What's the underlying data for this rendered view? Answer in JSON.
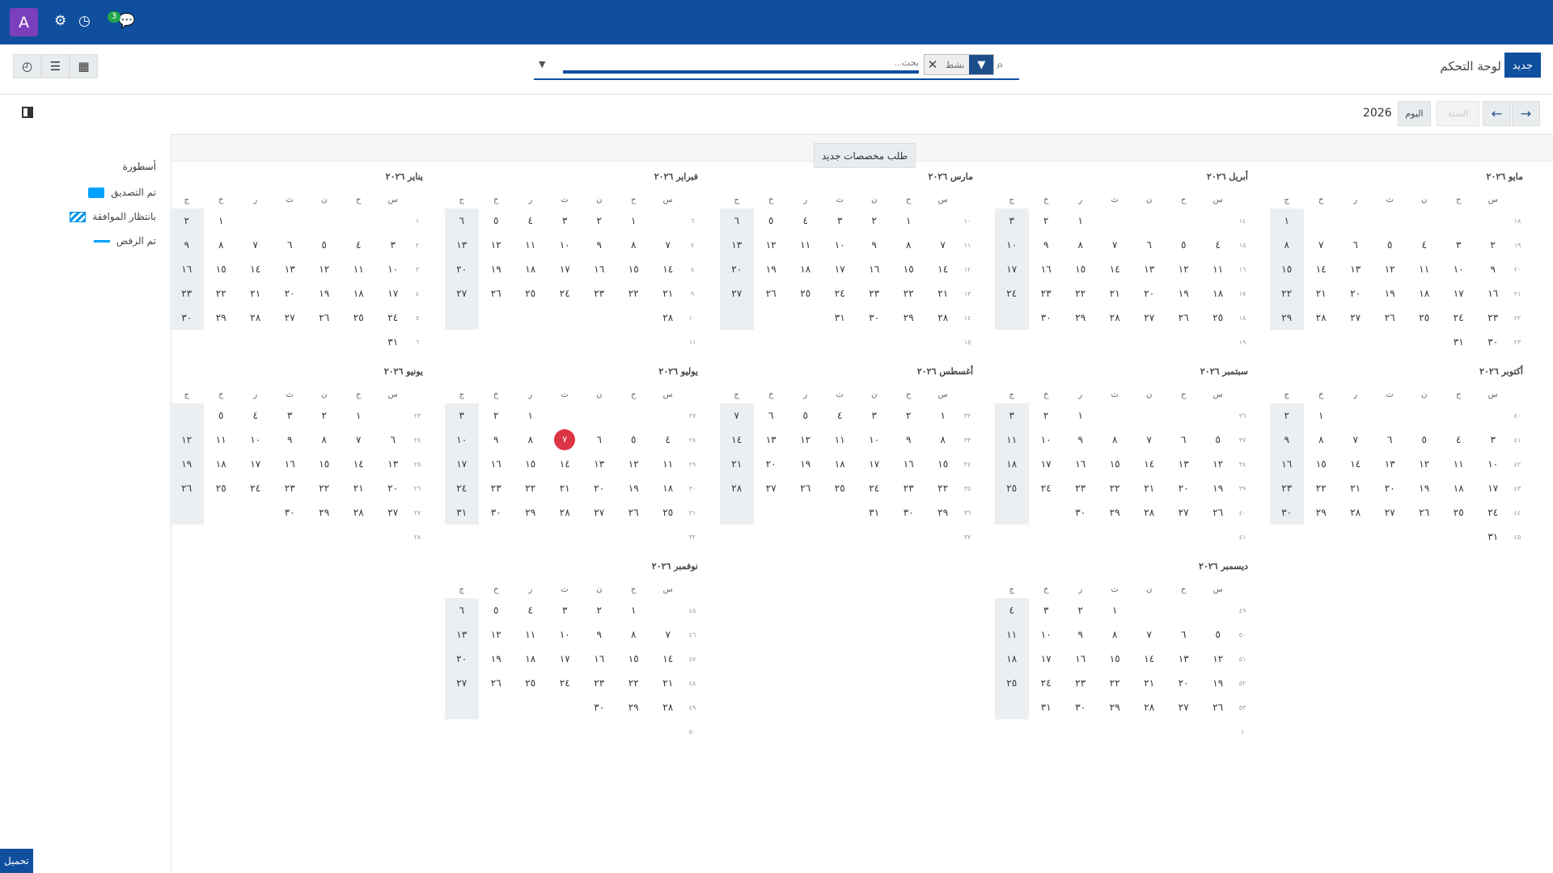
{
  "navbar": {
    "avatar_letter": "A",
    "messages_badge": "3"
  },
  "control_panel": {
    "new_button": "جديد",
    "breadcrumb": "لوحة التحكم",
    "search_placeholder": "بحث...",
    "facet_value": "نشط"
  },
  "toolbar": {
    "today_label": "اليوم",
    "scale_label": "السنة",
    "year": "2026"
  },
  "alloc_button": "طلب مخصصات جديد",
  "legend": {
    "title": "أسطورة",
    "items": [
      {
        "label": "تم التصديق",
        "style": "approved",
        "color": "#00a2ff"
      },
      {
        "label": "بانتظار الموافقة",
        "style": "pending",
        "color": "#0095e8"
      },
      {
        "label": "تم الرفض",
        "style": "refused",
        "color": "#00a2ff"
      }
    ]
  },
  "weekday_headers": [
    "س",
    "ح",
    "ن",
    "ث",
    "ر",
    "خ",
    "ج"
  ],
  "today": {
    "month": 7,
    "day": 7
  },
  "months": [
    {
      "title": "يناير ٢٠٢٦",
      "weeks": [
        "١",
        "٢",
        "٣",
        "٤",
        "٥",
        "٦"
      ],
      "rows": [
        [
          "",
          "",
          "",
          "",
          "",
          "١",
          "٢"
        ],
        [
          "٣",
          "٤",
          "٥",
          "٦",
          "٧",
          "٨",
          "٩"
        ],
        [
          "١٠",
          "١١",
          "١٢",
          "١٣",
          "١٤",
          "١٥",
          "١٦"
        ],
        [
          "١٧",
          "١٨",
          "١٩",
          "٢٠",
          "٢١",
          "٢٢",
          "٢٣"
        ],
        [
          "٢٤",
          "٢٥",
          "٢٦",
          "٢٧",
          "٢٨",
          "٢٩",
          "٣٠"
        ],
        [
          "٣١",
          "",
          "",
          "",
          "",
          "",
          ""
        ]
      ]
    },
    {
      "title": "فبراير ٢٠٢٦",
      "weeks": [
        "٦",
        "٧",
        "٨",
        "٩",
        "١٠",
        "١١"
      ],
      "rows": [
        [
          "",
          "١",
          "٢",
          "٣",
          "٤",
          "٥",
          "٦"
        ],
        [
          "٧",
          "٨",
          "٩",
          "١٠",
          "١١",
          "١٢",
          "١٣"
        ],
        [
          "١٤",
          "١٥",
          "١٦",
          "١٧",
          "١٨",
          "١٩",
          "٢٠"
        ],
        [
          "٢١",
          "٢٢",
          "٢٣",
          "٢٤",
          "٢٥",
          "٢٦",
          "٢٧"
        ],
        [
          "٢٨",
          "",
          "",
          "",
          "",
          "",
          ""
        ],
        [
          "",
          "",
          "",
          "",
          "",
          "",
          ""
        ]
      ]
    },
    {
      "title": "مارس ٢٠٢٦",
      "weeks": [
        "١٠",
        "١١",
        "١٢",
        "١٣",
        "١٤",
        "١٥"
      ],
      "rows": [
        [
          "",
          "١",
          "٢",
          "٣",
          "٤",
          "٥",
          "٦"
        ],
        [
          "٧",
          "٨",
          "٩",
          "١٠",
          "١١",
          "١٢",
          "١٣"
        ],
        [
          "١٤",
          "١٥",
          "١٦",
          "١٧",
          "١٨",
          "١٩",
          "٢٠"
        ],
        [
          "٢١",
          "٢٢",
          "٢٣",
          "٢٤",
          "٢٥",
          "٢٦",
          "٢٧"
        ],
        [
          "٢٨",
          "٢٩",
          "٣٠",
          "٣١",
          "",
          "",
          ""
        ],
        [
          "",
          "",
          "",
          "",
          "",
          "",
          ""
        ]
      ]
    },
    {
      "title": "أبريل ٢٠٢٦",
      "weeks": [
        "١٤",
        "١٥",
        "١٦",
        "١٧",
        "١٨",
        "١٩"
      ],
      "rows": [
        [
          "",
          "",
          "",
          "",
          "١",
          "٢",
          "٣"
        ],
        [
          "٤",
          "٥",
          "٦",
          "٧",
          "٨",
          "٩",
          "١٠"
        ],
        [
          "١١",
          "١٢",
          "١٣",
          "١٤",
          "١٥",
          "١٦",
          "١٧"
        ],
        [
          "١٨",
          "١٩",
          "٢٠",
          "٢١",
          "٢٢",
          "٢٣",
          "٢٤"
        ],
        [
          "٢٥",
          "٢٦",
          "٢٧",
          "٢٨",
          "٢٩",
          "٣٠",
          ""
        ],
        [
          "",
          "",
          "",
          "",
          "",
          "",
          ""
        ]
      ]
    },
    {
      "title": "مايو ٢٠٢٦",
      "weeks": [
        "١٨",
        "١٩",
        "٢٠",
        "٢١",
        "٢٢",
        "٢٣"
      ],
      "rows": [
        [
          "",
          "",
          "",
          "",
          "",
          "",
          "١"
        ],
        [
          "٢",
          "٣",
          "٤",
          "٥",
          "٦",
          "٧",
          "٨"
        ],
        [
          "٩",
          "١٠",
          "١١",
          "١٢",
          "١٣",
          "١٤",
          "١٥"
        ],
        [
          "١٦",
          "١٧",
          "١٨",
          "١٩",
          "٢٠",
          "٢١",
          "٢٢"
        ],
        [
          "٢٣",
          "٢٤",
          "٢٥",
          "٢٦",
          "٢٧",
          "٢٨",
          "٢٩"
        ],
        [
          "٣٠",
          "٣١",
          "",
          "",
          "",
          "",
          ""
        ]
      ]
    },
    {
      "title": "يونيو ٢٠٢٦",
      "weeks": [
        "٢٣",
        "٢٤",
        "٢٥",
        "٢٦",
        "٢٧",
        "٢٨"
      ],
      "rows": [
        [
          "",
          "١",
          "٢",
          "٣",
          "٤",
          "٥",
          ""
        ],
        [
          "٦",
          "٧",
          "٨",
          "٩",
          "١٠",
          "١١",
          "١٢"
        ],
        [
          "١٣",
          "١٤",
          "١٥",
          "١٦",
          "١٧",
          "١٨",
          "١٩"
        ],
        [
          "٢٠",
          "٢١",
          "٢٢",
          "٢٣",
          "٢٤",
          "٢٥",
          "٢٦"
        ],
        [
          "٢٧",
          "٢٨",
          "٢٩",
          "٣٠",
          "",
          "",
          ""
        ],
        [
          "",
          "",
          "",
          "",
          "",
          "",
          ""
        ]
      ]
    },
    {
      "title": "يوليو ٢٠٢٦",
      "weeks": [
        "٢٧",
        "٢٨",
        "٢٩",
        "٣٠",
        "٣١",
        "٣٢"
      ],
      "rows": [
        [
          "",
          "",
          "",
          "",
          "١",
          "٢",
          "٣"
        ],
        [
          "٤",
          "٥",
          "٦",
          "٧",
          "٨",
          "٩",
          "١٠"
        ],
        [
          "١١",
          "١٢",
          "١٣",
          "١٤",
          "١٥",
          "١٦",
          "١٧"
        ],
        [
          "١٨",
          "١٩",
          "٢٠",
          "٢١",
          "٢٢",
          "٢٣",
          "٢٤"
        ],
        [
          "٢٥",
          "٢٦",
          "٢٧",
          "٢٨",
          "٢٩",
          "٣٠",
          "٣١"
        ],
        [
          "",
          "",
          "",
          "",
          "",
          "",
          ""
        ]
      ]
    },
    {
      "title": "أغسطس ٢٠٢٦",
      "weeks": [
        "٣٢",
        "٣٣",
        "٣٤",
        "٣٥",
        "٣٦",
        "٣٧"
      ],
      "rows": [
        [
          "١",
          "٢",
          "٣",
          "٤",
          "٥",
          "٦",
          "٧"
        ],
        [
          "٨",
          "٩",
          "١٠",
          "١١",
          "١٢",
          "١٣",
          "١٤"
        ],
        [
          "١٥",
          "١٦",
          "١٧",
          "١٨",
          "١٩",
          "٢٠",
          "٢١"
        ],
        [
          "٢٢",
          "٢٣",
          "٢٤",
          "٢٥",
          "٢٦",
          "٢٧",
          "٢٨"
        ],
        [
          "٢٩",
          "٣٠",
          "٣١",
          "",
          "",
          "",
          ""
        ],
        [
          "",
          "",
          "",
          "",
          "",
          "",
          ""
        ]
      ]
    },
    {
      "title": "سبتمبر ٢٠٢٦",
      "weeks": [
        "٣٦",
        "٣٧",
        "٣٨",
        "٣٩",
        "٤٠",
        "٤١"
      ],
      "rows": [
        [
          "",
          "",
          "",
          "",
          "١",
          "٢",
          "٣"
        ],
        [
          "٥",
          "٦",
          "٧",
          "٨",
          "٩",
          "١٠",
          "١١"
        ],
        [
          "١٢",
          "١٣",
          "١٤",
          "١٥",
          "١٦",
          "١٧",
          "١٨"
        ],
        [
          "١٩",
          "٢٠",
          "٢١",
          "٢٢",
          "٢٣",
          "٢٤",
          "٢٥"
        ],
        [
          "٢٦",
          "٢٧",
          "٢٨",
          "٢٩",
          "٣٠",
          "",
          ""
        ],
        [
          "",
          "",
          "",
          "",
          "",
          "",
          ""
        ]
      ]
    },
    {
      "title": "أكتوبر ٢٠٢٦",
      "weeks": [
        "٤٠",
        "٤١",
        "٤٢",
        "٤٣",
        "٤٤",
        "٤٥"
      ],
      "rows": [
        [
          "",
          "",
          "",
          "",
          "",
          "١",
          "٢"
        ],
        [
          "٣",
          "٤",
          "٥",
          "٦",
          "٧",
          "٨",
          "٩"
        ],
        [
          "١٠",
          "١١",
          "١٢",
          "١٣",
          "١٤",
          "١٥",
          "١٦"
        ],
        [
          "١٧",
          "١٨",
          "١٩",
          "٢٠",
          "٢١",
          "٢٢",
          "٢٣"
        ],
        [
          "٢٤",
          "٢٥",
          "٢٦",
          "٢٧",
          "٢٨",
          "٢٩",
          "٣٠"
        ],
        [
          "٣١",
          "",
          "",
          "",
          "",
          "",
          ""
        ]
      ]
    },
    {
      "title": "نوفمبر ٢٠٢٦",
      "weeks": [
        "٤٥",
        "٤٦",
        "٤٧",
        "٤٨",
        "٤٩",
        "٥٠"
      ],
      "rows": [
        [
          "",
          "١",
          "٢",
          "٣",
          "٤",
          "٥",
          "٦"
        ],
        [
          "٧",
          "٨",
          "٩",
          "١٠",
          "١١",
          "١٢",
          "١٣"
        ],
        [
          "١٤",
          "١٥",
          "١٦",
          "١٧",
          "١٨",
          "١٩",
          "٢٠"
        ],
        [
          "٢١",
          "٢٢",
          "٢٣",
          "٢٤",
          "٢٥",
          "٢٦",
          "٢٧"
        ],
        [
          "٢٨",
          "٢٩",
          "٣٠",
          "",
          "",
          "",
          ""
        ],
        [
          "",
          "",
          "",
          "",
          "",
          "",
          ""
        ]
      ]
    },
    {
      "title": "ديسمبر ٢٠٢٦",
      "weeks": [
        "٤٩",
        "٥٠",
        "٥١",
        "٥٢",
        "٥٣",
        "١"
      ],
      "rows": [
        [
          "",
          "",
          "",
          "١",
          "٢",
          "٣",
          "٤"
        ],
        [
          "٥",
          "٦",
          "٧",
          "٨",
          "٩",
          "١٠",
          "١١"
        ],
        [
          "١٢",
          "١٣",
          "١٤",
          "١٥",
          "١٦",
          "١٧",
          "١٨"
        ],
        [
          "١٩",
          "٢٠",
          "٢١",
          "٢٢",
          "٢٣",
          "٢٤",
          "٢٥"
        ],
        [
          "٢٦",
          "٢٧",
          "٢٨",
          "٢٩",
          "٣٠",
          "٣١",
          ""
        ],
        [
          "",
          "",
          "",
          "",
          "",
          "",
          ""
        ]
      ]
    }
  ],
  "load_more": "تحميل"
}
